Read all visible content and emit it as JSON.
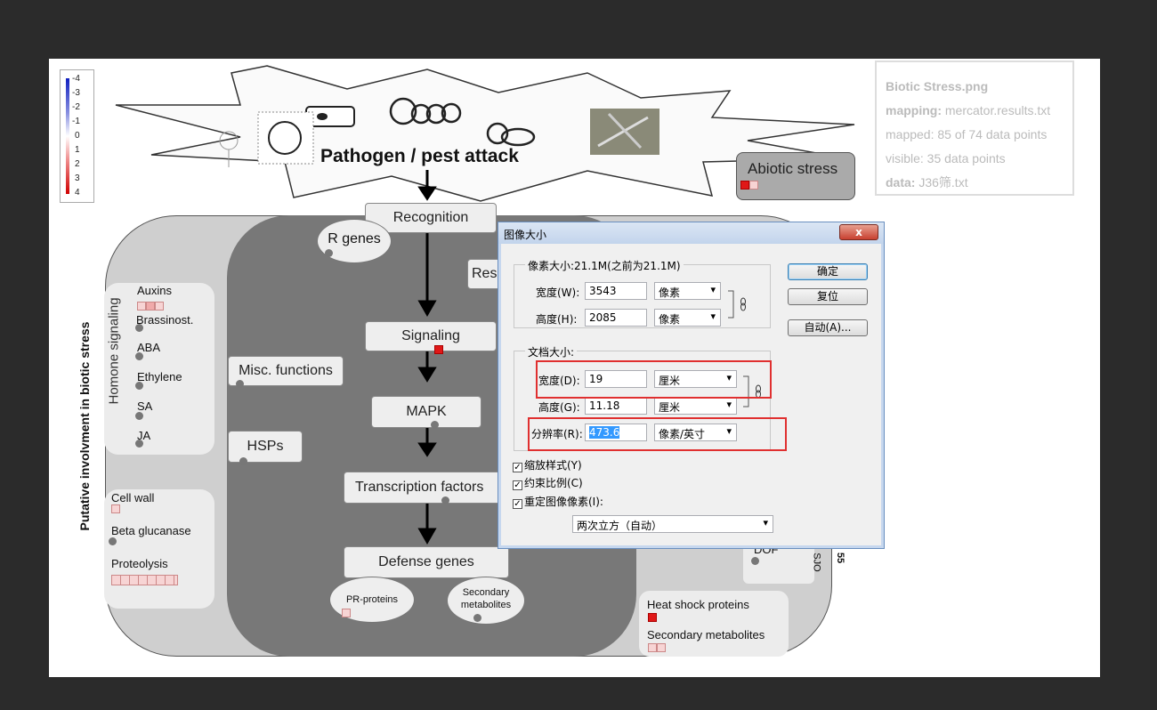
{
  "legend": {
    "ticks": [
      "-4",
      "-3",
      "-2",
      "-1",
      "0",
      "1",
      "2",
      "3",
      "4"
    ]
  },
  "info_panel": {
    "file": "Biotic Stress.png",
    "mapping_label": "mapping:",
    "mapping_value": "mercator.results.txt",
    "mapped": "mapped: 85 of 74 data points",
    "visible": "visible: 35 data points",
    "data_label": "data:",
    "data_value": "J36筛.txt"
  },
  "pathway": {
    "banner": "Pathogen / pest attack",
    "abiotic": "Abiotic stress",
    "vertical_title": "Putative involvment in biotic stress",
    "hormone_title": "Homone signaling",
    "hormones": [
      "Auxins",
      "Brassinost.",
      "ABA",
      "Ethylene",
      "SA",
      "JA"
    ],
    "recognition": "Recognition",
    "r_genes": "R genes",
    "resistance_partial": "Res",
    "signaling": "Signaling",
    "misc": "Misc. functions",
    "mapk": "MAPK",
    "hsps": "HSPs",
    "tf": "Transcription factors",
    "defense": "Defense genes",
    "pr_proteins": "PR-proteins",
    "secondary_metabolites_oval": "Secondary metabolites",
    "cell_wall": "Cell wall",
    "beta_glucanase": "Beta glucanase",
    "proteolysis": "Proteolysis",
    "heat_shock": "Heat shock proteins",
    "secondary_metabolites": "Secondary metabolites",
    "partial_dof": "DOF",
    "partial_side": "SJO",
    "partial_side2": "55"
  },
  "colors": {
    "up_strong": "#e01818",
    "up_light": "#f7d4d4",
    "panel_dark": "#787878"
  },
  "dialog": {
    "title": "图像大小",
    "close": "x",
    "pixel_group": "像素大小:21.1M(之前为21.1M)",
    "width_label": "宽度(W):",
    "width_value": "3543",
    "width_unit": "像素",
    "height_label": "高度(H):",
    "height_value": "2085",
    "height_unit": "像素",
    "doc_group": "文档大小:",
    "doc_width_label": "宽度(D):",
    "doc_width_value": "19",
    "doc_width_unit": "厘米",
    "doc_height_label": "高度(G):",
    "doc_height_value": "11.18",
    "doc_height_unit": "厘米",
    "res_label": "分辨率(R):",
    "res_value": "473.6",
    "res_unit": "像素/英寸",
    "scale_styles": "缩放样式(Y)",
    "constrain": "约束比例(C)",
    "resample": "重定图像像素(I):",
    "resample_method": "两次立方（自动）",
    "ok": "确定",
    "reset": "复位",
    "auto": "自动(A)..."
  }
}
